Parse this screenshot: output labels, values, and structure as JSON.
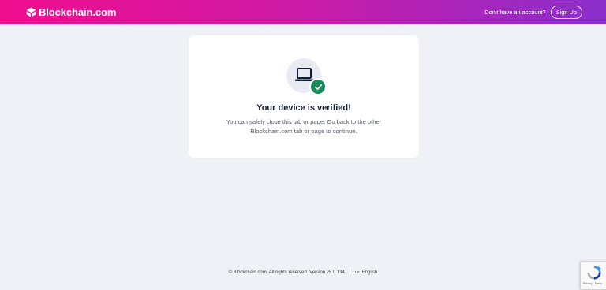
{
  "header": {
    "logo_text": "Blockchain.com",
    "account_prompt": "Don't have an account?",
    "signup_label": "Sign Up"
  },
  "card": {
    "title": "Your device is verified!",
    "body": "You can safely close this tab or page. Go back to the other Blockchain.com tab or page to continue.",
    "icons": [
      "laptop-icon",
      "check-icon"
    ]
  },
  "footer": {
    "copyright": "© Blockchain.com. All rights reserved. Version v5.0.134",
    "language_flag": "us",
    "language": "English"
  },
  "recaptcha": {
    "links": "Privacy - Terms"
  },
  "colors": {
    "header_gradient_start": "#f00e8e",
    "header_gradient_end": "#8b2fcc",
    "page_background": "#f0f1f7",
    "success_green": "#188a5b",
    "title_text": "#121d33"
  }
}
